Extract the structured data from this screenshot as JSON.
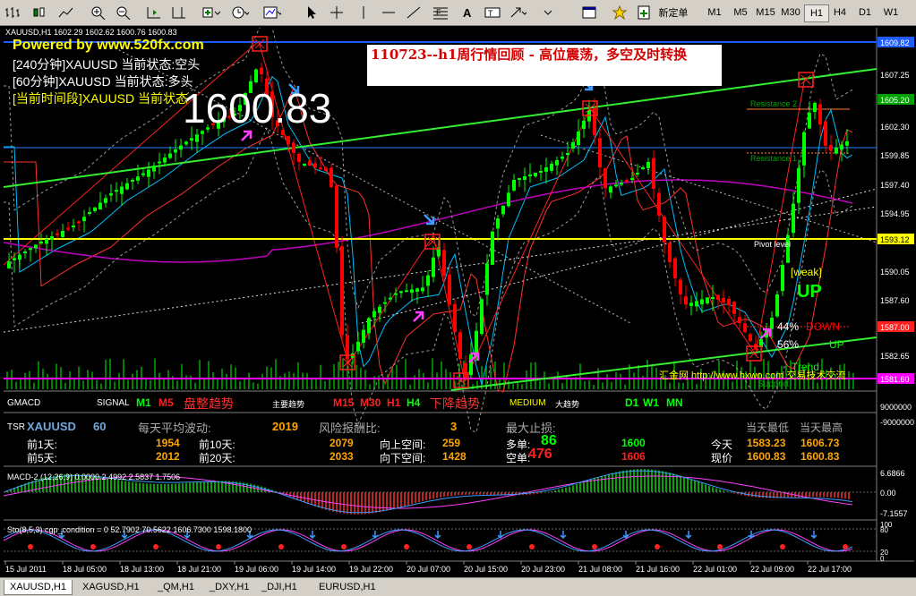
{
  "toolbar": {
    "new_order_label": "新定单",
    "timeframes": [
      "M1",
      "M5",
      "M15",
      "M30",
      "H1",
      "H4",
      "D1",
      "W1"
    ],
    "active_timeframe": "H1"
  },
  "chart": {
    "symbol_line": "XAUUSD,H1  1602.29 1602.62 1600.76 1600.83",
    "powered_by": "Powered by www.520fx.com",
    "status_240": "[240分钟]XAUUSD 当前状态:空头",
    "status_60": "[60分钟]XAUUSD 当前状态:多头",
    "status_current": "[当前时间段]XAUUSD 当前状态",
    "big_price": "1600.83",
    "headline": "110723--h1周行情回顾 - 高位震荡，多空及时转换",
    "resistance1": "Resistance 2",
    "resistance2": "Resistance 1",
    "pivot_label": "Pivot level",
    "weak": "[weak]",
    "up": "UP",
    "pct_down": "44%",
    "down_label": "DOWN",
    "pct_up": "56%",
    "up_small": "UP",
    "trend": "Trend",
    "support": "Support",
    "watermark": "汇金网 http://www.hxwo.com 交易技术交流",
    "price_axis": [
      "1609.82",
      "1607.25",
      "1605.20",
      "1602.30",
      "1599.85",
      "1597.40",
      "1594.95",
      "1593.12",
      "1590.05",
      "1587.60",
      "1585.15",
      "1582.65",
      "1581.60"
    ],
    "highlight_prices": {
      "top": "1609.82",
      "green": "1605.20",
      "yellow": "1593.12",
      "red": "1587.00",
      "pink": "1581.60"
    }
  },
  "gmacd": {
    "label": "GMACD",
    "signal": "SIGNAL",
    "m1": "M1",
    "m5": "M5",
    "trend1": "盘整趋势",
    "main_trend": "主要趋势",
    "m15": "M15",
    "m30": "M30",
    "h1": "H1",
    "h4": "H4",
    "trend2": "下降趋势",
    "medium": "MEDIUM",
    "big_trend": "大趋势",
    "d1": "D1",
    "w1": "W1",
    "mn": "MN",
    "axis": [
      "9000000",
      "-9000000"
    ]
  },
  "tsr": {
    "label": "TSR",
    "symbol": "XAUUSD",
    "period": "60",
    "avg_label": "每天平均波动:",
    "avg_value": "2019",
    "rr_label": "风险报酬比:",
    "rr_value": "3",
    "max_sl_label": "最大止损:",
    "today_low_label": "当天最低",
    "today_high_label": "当天最高",
    "prev1_label": "前1天:",
    "prev1": "1954",
    "prev10_label": "前10天:",
    "prev10": "2079",
    "upspace_label": "向上空间:",
    "upspace": "259",
    "long_label": "多单:",
    "long_val": "86",
    "long_price": "1600",
    "today_label": "今天",
    "today_low": "1583.23",
    "today_high": "1606.73",
    "prev5_label": "前5天:",
    "prev5": "2012",
    "prev20_label": "前20天:",
    "prev20": "2033",
    "downspace_label": "向下空间:",
    "downspace": "1428",
    "short_label": "空单:",
    "short_val": "476",
    "short_price": "1606",
    "now_label": "现价",
    "now_low": "1600.83",
    "now_high": "1600.83"
  },
  "macd": {
    "label": "MACD-2 (12,26,9) 0.0000 2.4992 2.5837 1.7506",
    "axis": [
      "6.6866",
      "0.00",
      "-7.1557"
    ]
  },
  "sto": {
    "label": "Sto(8,5,3) cgp_condition = 0  52.7902 70.5622 1606.7300 1598.1800",
    "axis": [
      "100",
      "80",
      "20",
      "0"
    ]
  },
  "time_axis": [
    "15 Jul 2011",
    "18 Jul 05:00",
    "18 Jul 13:00",
    "18 Jul 21:00",
    "19 Jul 06:00",
    "19 Jul 14:00",
    "19 Jul 22:00",
    "20 Jul 07:00",
    "20 Jul 15:00",
    "20 Jul 23:00",
    "21 Jul 08:00",
    "21 Jul 16:00",
    "22 Jul 01:00",
    "22 Jul 09:00",
    "22 Jul 17:00"
  ],
  "tabs": [
    "XAUUSD,H1",
    "XAGUSD,H1",
    "_QM,H1",
    "_DXY,H1",
    "_DJI,H1",
    "EURUSD,H1"
  ],
  "colors": {
    "bull": "#00ff00",
    "bear": "#ff0000",
    "blue_line": "#1e5cff",
    "green_line": "#33ee33",
    "yellow_line": "#ffff00"
  }
}
